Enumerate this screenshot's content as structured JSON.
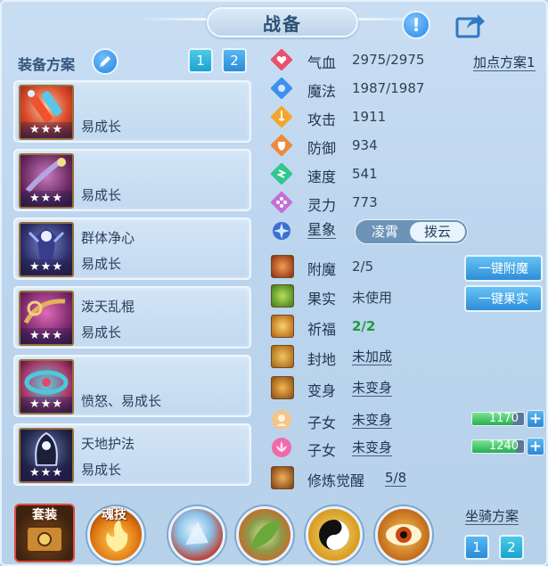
{
  "header": {
    "title": "战备"
  },
  "equip": {
    "title": "装备方案",
    "plans": [
      "1",
      "2"
    ],
    "items": [
      {
        "name": "",
        "trait": "易成长",
        "stars": "★★★"
      },
      {
        "name": "",
        "trait": "易成长",
        "stars": "★★★"
      },
      {
        "name": "群体净心",
        "trait": "易成长",
        "stars": "★★★"
      },
      {
        "name": "泼天乱棍",
        "trait": "易成长",
        "stars": "★★★"
      },
      {
        "name": "",
        "trait": "愤怒、易成长",
        "stars": "★★★"
      },
      {
        "name": "天地护法",
        "trait": "易成长",
        "stars": "★★★"
      }
    ]
  },
  "stats": {
    "points_plan": "加点方案1",
    "rows": [
      {
        "label": "气血",
        "value": "2975/2975",
        "icon": "heart-icon",
        "color": "#e9506c"
      },
      {
        "label": "魔法",
        "value": "1987/1987",
        "icon": "mana-icon",
        "color": "#3e8ff0"
      },
      {
        "label": "攻击",
        "value": "1911",
        "icon": "sword-icon",
        "color": "#f3a62d"
      },
      {
        "label": "防御",
        "value": "934",
        "icon": "shield-icon",
        "color": "#ef8a3a"
      },
      {
        "label": "速度",
        "value": "541",
        "icon": "speed-icon",
        "color": "#2fc78c"
      },
      {
        "label": "灵力",
        "value": "773",
        "icon": "spirit-icon",
        "color": "#c46fd8"
      }
    ],
    "astro": {
      "label": "星象",
      "options": [
        "凌霄",
        "拨云"
      ],
      "selected": "拨云"
    }
  },
  "skills": {
    "enchant": {
      "label": "附魔",
      "value": "2/5",
      "button": "一键附魔"
    },
    "fruit": {
      "label": "果实",
      "value": "未使用",
      "button": "一键果实"
    },
    "blessing": {
      "label": "祈福",
      "value": "2/2",
      "value_color": "#1f9a3a"
    },
    "seal": {
      "label": "封地",
      "value": "未加成"
    },
    "transform": {
      "label": "变身",
      "value": "未变身"
    },
    "child1": {
      "label": "子女",
      "value": "未变身",
      "bar_value": "1170",
      "bar_fill": 0.8
    },
    "child2": {
      "label": "子女",
      "value": "未变身",
      "bar_value": "1240",
      "bar_fill": 0.85
    },
    "awaken": {
      "label": "修炼觉醒",
      "value": "5/8"
    }
  },
  "bottom": {
    "suit_label": "套装",
    "soul_label": "魂技",
    "mount_title": "坐骑方案",
    "mount_plans": [
      "1",
      "2"
    ]
  }
}
